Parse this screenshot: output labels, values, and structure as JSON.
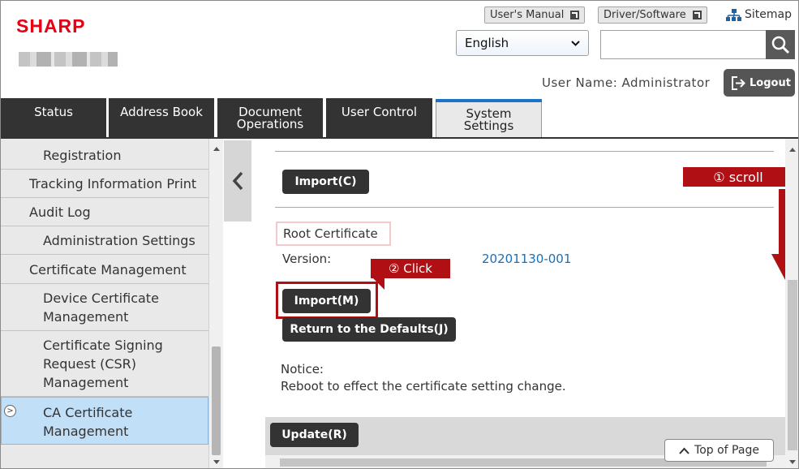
{
  "header": {
    "logo": "SHARP",
    "users_manual": "User's Manual",
    "driver_software": "Driver/Software",
    "sitemap": "Sitemap",
    "language": "English",
    "search_value": "",
    "user_name": "User Name: Administrator",
    "logout": "Logout"
  },
  "tabs": [
    {
      "label": "Status",
      "active": false
    },
    {
      "label": "Address Book",
      "active": false
    },
    {
      "label": "Document Operations",
      "active": false
    },
    {
      "label": "User Control",
      "active": false
    },
    {
      "label": "System Settings",
      "active": true
    }
  ],
  "sidebar": {
    "items": [
      {
        "label": "Registration",
        "indent": 2
      },
      {
        "label": "Tracking Information Print",
        "indent": 1
      },
      {
        "label": "Audit Log",
        "indent": 1
      },
      {
        "label": "Administration Settings",
        "indent": 2
      },
      {
        "label": "Certificate Management",
        "indent": 1
      },
      {
        "label": "Device Certificate Management",
        "indent": 2
      },
      {
        "label": "Certificate Signing Request (CSR) Management",
        "indent": 2
      },
      {
        "label": "CA Certificate Management",
        "indent": 2,
        "selected": true
      }
    ]
  },
  "main": {
    "import_c": "Import(C)",
    "root_certificate": "Root Certificate",
    "version_label": "Version:",
    "version_value": "20201130-001",
    "import_m": "Import(M)",
    "return_defaults": "Return to the Defaults(J)",
    "notice_label": "Notice:",
    "notice_text": "Reboot to effect the certificate setting change.",
    "update": "Update(R)",
    "top_of_page": "Top of Page"
  },
  "annotations": {
    "scroll": "① scroll",
    "click": "② Click",
    "color": "#b01014"
  }
}
